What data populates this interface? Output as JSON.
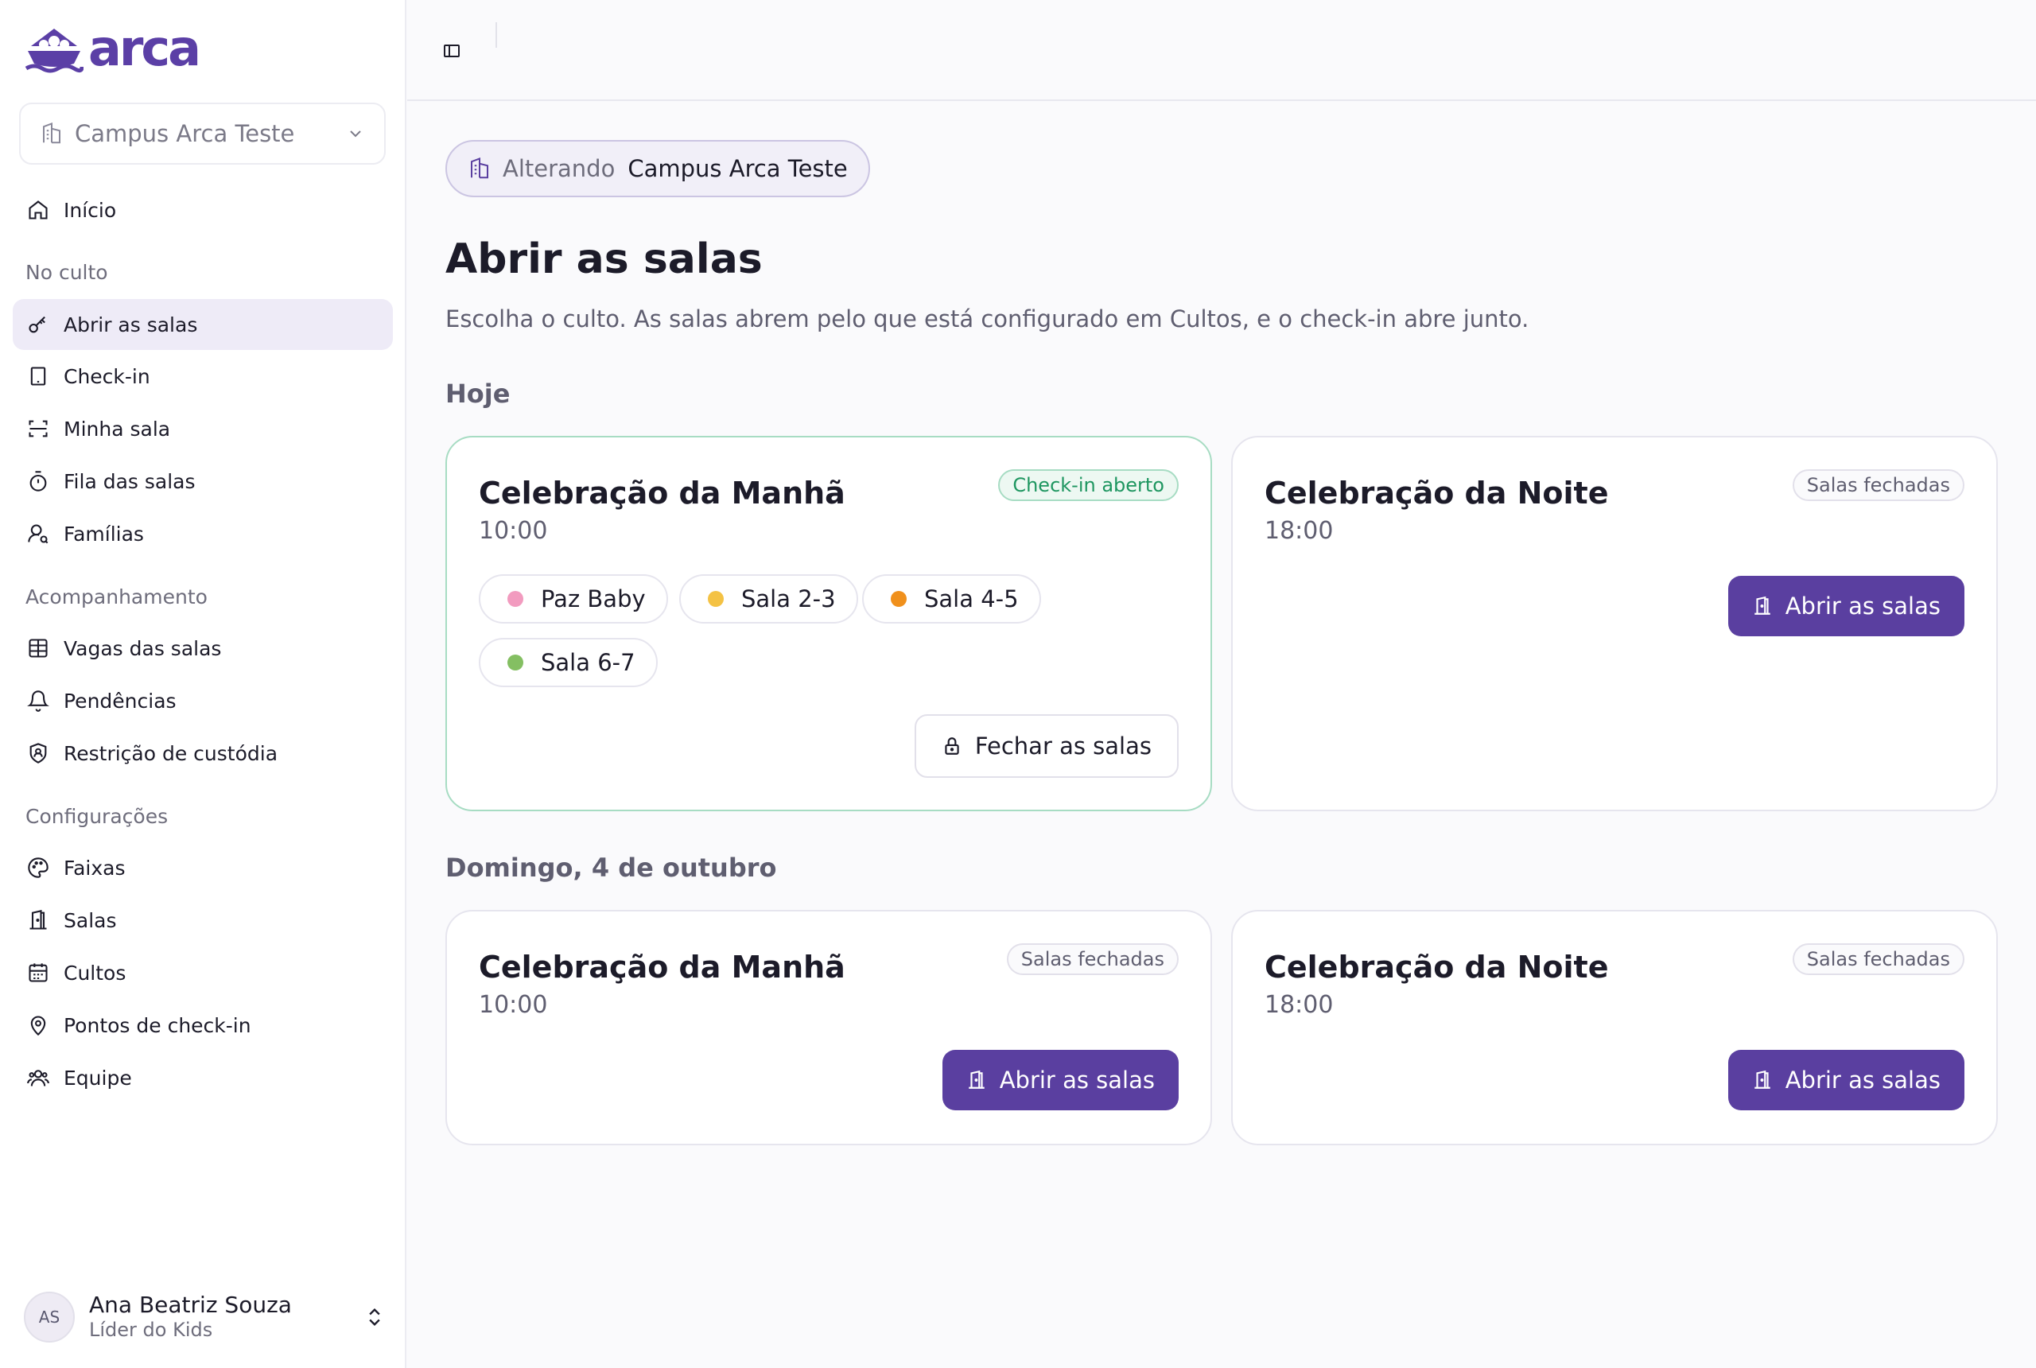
{
  "brand": {
    "name": "arca",
    "accent": "#5a3fa0"
  },
  "campus_selector": {
    "value": "Campus Arca Teste"
  },
  "nav": {
    "home": "Início",
    "sections": [
      {
        "title": "No culto",
        "items": [
          "Abrir as salas",
          "Check-in",
          "Minha sala",
          "Fila das salas",
          "Famílias"
        ]
      },
      {
        "title": "Acompanhamento",
        "items": [
          "Vagas das salas",
          "Pendências",
          "Restrição de custódia"
        ]
      },
      {
        "title": "Configurações",
        "items": [
          "Faixas",
          "Salas",
          "Cultos",
          "Pontos de check-in",
          "Equipe"
        ]
      }
    ]
  },
  "user": {
    "initials": "AS",
    "name": "Ana Beatriz Souza",
    "role": "Líder do Kids"
  },
  "context_chip": {
    "prefix": "Alterando",
    "campus": "Campus Arca Teste"
  },
  "page": {
    "title": "Abrir as salas",
    "subtitle": "Escolha o culto. As salas abrem pelo que está configurado em Cultos, e o check-in abre junto."
  },
  "groups": [
    {
      "heading": "Hoje",
      "services": [
        {
          "title": "Celebração da Manhã",
          "time": "10:00",
          "status": "Check-in aberto",
          "rooms": [
            {
              "name": "Paz Baby",
              "color": "#f29bbf"
            },
            {
              "name": "Sala 2-3",
              "color": "#f4c244"
            },
            {
              "name": "Sala 4-5",
              "color": "#f0901c"
            },
            {
              "name": "Sala 6-7",
              "color": "#84bf62"
            }
          ],
          "action": "Fechar as salas"
        },
        {
          "title": "Celebração da Noite",
          "time": "18:00",
          "status": "Salas fechadas",
          "action": "Abrir as salas"
        }
      ]
    },
    {
      "heading": "Domingo, 4 de outubro",
      "services": [
        {
          "title": "Celebração da Manhã",
          "time": "10:00",
          "status": "Salas fechadas",
          "action": "Abrir as salas"
        },
        {
          "title": "Celebração da Noite",
          "time": "18:00",
          "status": "Salas fechadas",
          "action": "Abrir as salas"
        }
      ]
    }
  ]
}
